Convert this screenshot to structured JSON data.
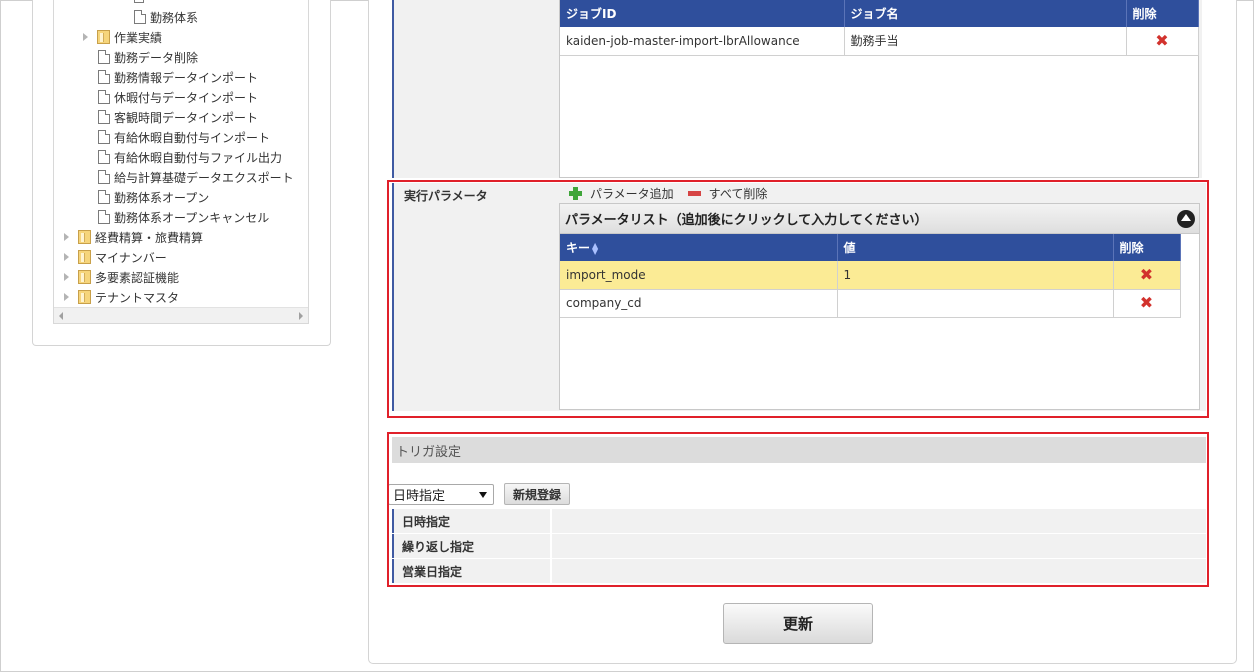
{
  "tree": {
    "items": [
      {
        "label": "勤務体系",
        "type": "doc",
        "indent": 2
      },
      {
        "label": "作業実績",
        "type": "folder",
        "indent": 1
      },
      {
        "label": "勤務データ削除",
        "type": "doc",
        "indent": 1
      },
      {
        "label": "勤務情報データインポート",
        "type": "doc",
        "indent": 1
      },
      {
        "label": "休暇付与データインポート",
        "type": "doc",
        "indent": 1
      },
      {
        "label": "客観時間データインポート",
        "type": "doc",
        "indent": 1
      },
      {
        "label": "有給休暇自動付与インポート",
        "type": "doc",
        "indent": 1
      },
      {
        "label": "有給休暇自動付与ファイル出力",
        "type": "doc",
        "indent": 1
      },
      {
        "label": "給与計算基礎データエクスポート",
        "type": "doc",
        "indent": 1
      },
      {
        "label": "勤務体系オープン",
        "type": "doc",
        "indent": 1
      },
      {
        "label": "勤務体系オープンキャンセル",
        "type": "doc",
        "indent": 1
      },
      {
        "label": "経費精算・旅費精算",
        "type": "folder",
        "indent": 0
      },
      {
        "label": "マイナンバー",
        "type": "folder",
        "indent": 0
      },
      {
        "label": "多要素認証機能",
        "type": "folder",
        "indent": 0
      },
      {
        "label": "テナントマスタ",
        "type": "folder",
        "indent": 0
      }
    ]
  },
  "jobs": {
    "headers": {
      "id": "ジョブID",
      "name": "ジョブ名",
      "delete": "削除"
    },
    "rows": [
      {
        "id": "kaiden-job-master-import-lbrAllowance",
        "name": "勤務手当"
      }
    ]
  },
  "params": {
    "section_label": "実行パラメータ",
    "add_label": "パラメータ追加",
    "delete_all_label": "すべて削除",
    "grid_title": "パラメータリスト（追加後にクリックして入力してください）",
    "headers": {
      "key": "キー",
      "value": "値",
      "delete": "削除"
    },
    "rows": [
      {
        "key": "import_mode",
        "value": "1"
      },
      {
        "key": "company_cd",
        "value": ""
      }
    ]
  },
  "trigger": {
    "title": "トリガ設定",
    "select_value": "日時指定",
    "new_button": "新規登録",
    "rows": [
      "日時指定",
      "繰り返し指定",
      "営業日指定"
    ]
  },
  "update_button": "更新",
  "colors": {
    "header_blue": "#2f4f9c",
    "highlight_red": "#e0202a",
    "selected_row": "#fbeb95",
    "delete_icon": "#d2322d"
  }
}
